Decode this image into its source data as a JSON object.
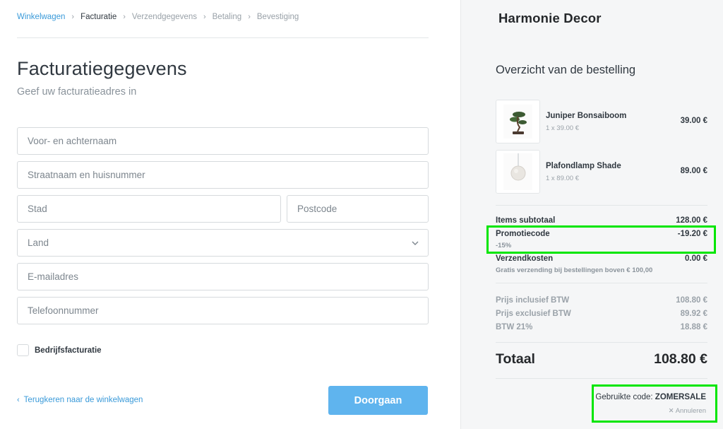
{
  "breadcrumb": {
    "items": [
      "Winkelwagen",
      "Facturatie",
      "Verzendgegevens",
      "Betaling",
      "Bevestiging"
    ]
  },
  "billing": {
    "title": "Facturatiegegevens",
    "subtitle": "Geef uw facturatieadres in",
    "fields": {
      "name": "Voor- en achternaam",
      "street": "Straatnaam en huisnummer",
      "city": "Stad",
      "postcode": "Postcode",
      "country": "Land",
      "email": "E-mailadres",
      "phone": "Telefoonnummer"
    },
    "company_checkbox": "Bedrijfsfacturatie",
    "back_link": "Terugkeren naar de winkelwagen",
    "continue_button": "Doorgaan"
  },
  "summary": {
    "brand": "Harmonie Decor",
    "title": "Overzicht van de bestelling",
    "products": [
      {
        "name": "Juniper Bonsaiboom",
        "qty": "1 x 39.00 €",
        "price": "39.00 €",
        "icon": "bonsai-tree-icon"
      },
      {
        "name": "Plafondlamp Shade",
        "qty": "1 x 89.00 €",
        "price": "89.00 €",
        "icon": "pendant-lamp-icon"
      }
    ],
    "subtotal": {
      "label": "Items subtotaal",
      "value": "128.00 €"
    },
    "promo": {
      "label": "Promotiecode",
      "note": "-15%",
      "value": "-19.20 €"
    },
    "shipping": {
      "label": "Verzendkosten",
      "note": "Gratis verzending bij bestellingen boven € 100,00",
      "value": "0.00 €"
    },
    "tax": [
      {
        "label": "Prijs inclusief BTW",
        "value": "108.80 €"
      },
      {
        "label": "Prijs exclusief BTW",
        "value": "89.92 €"
      },
      {
        "label": "BTW 21%",
        "value": "18.88 €"
      }
    ],
    "total": {
      "label": "Totaal",
      "value": "108.80 €"
    },
    "used_code": {
      "prefix": "Gebruikte code:",
      "code": "ZOMERSALE"
    },
    "cancel": "Annuleren",
    "colors": {
      "accent": "#5fb4ee",
      "link": "#3a9ad9",
      "highlight": "#00e600"
    }
  }
}
